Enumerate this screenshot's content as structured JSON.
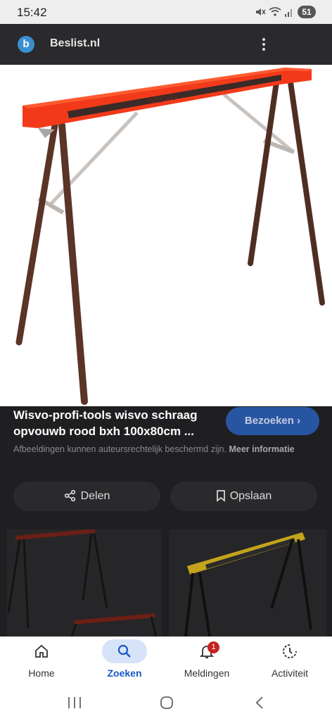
{
  "status_bar": {
    "time": "15:42",
    "battery": "51",
    "icons": [
      "mute-icon",
      "wifi-icon",
      "signal-icon",
      "battery-icon"
    ]
  },
  "header": {
    "logo_letter": "b",
    "site": "Beslist.nl"
  },
  "image": {
    "subject": "sawhorse",
    "brand_text": "WISVO"
  },
  "caption": {
    "title": "Wisvo-profi-tools wisvo schraag opvouwb rood bxh 100x80cm ...",
    "visit_label": "Bezoeken ›",
    "notice": "Afbeeldingen kunnen auteursrechtelijk beschermd zijn.",
    "notice_link": "Meer informatie"
  },
  "actions": {
    "share": "Delen",
    "save": "Opslaan"
  },
  "bottom_nav": [
    {
      "label": "Home"
    },
    {
      "label": "Zoeken"
    },
    {
      "label": "Meldingen",
      "badge": "1"
    },
    {
      "label": "Activiteit"
    }
  ],
  "colors": {
    "accent": "#1a57c4",
    "sawhorse_top": "#f23a1a",
    "legs": "#5a3426"
  }
}
